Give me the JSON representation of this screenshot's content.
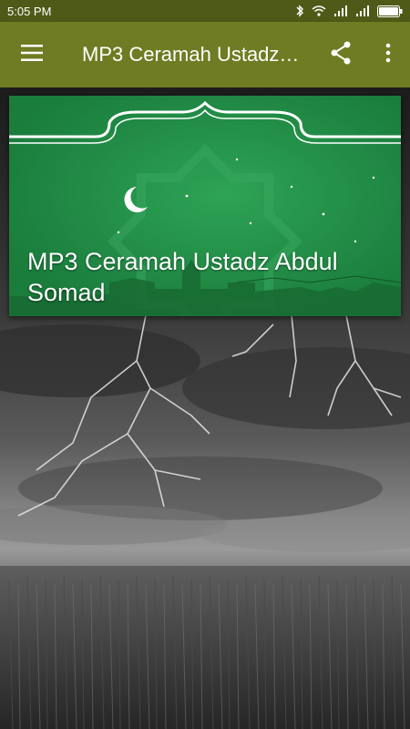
{
  "status_bar": {
    "time": "5:05 PM",
    "icons": [
      "bluetooth-icon",
      "wifi-icon",
      "signal-icon",
      "signal-icon",
      "battery-icon"
    ]
  },
  "app_bar": {
    "title": "MP3 Ceramah Ustadz Abdul Somad",
    "menu_icon": "hamburger-menu-icon",
    "share_icon": "share-icon",
    "more_icon": "more-vert-icon"
  },
  "banner_card": {
    "title": "MP3 Ceramah Ustadz Abdul Somad"
  },
  "colors": {
    "app_bar": "#6f7c23",
    "status_bar": "#505a18",
    "card_green": "#1f8a44"
  }
}
